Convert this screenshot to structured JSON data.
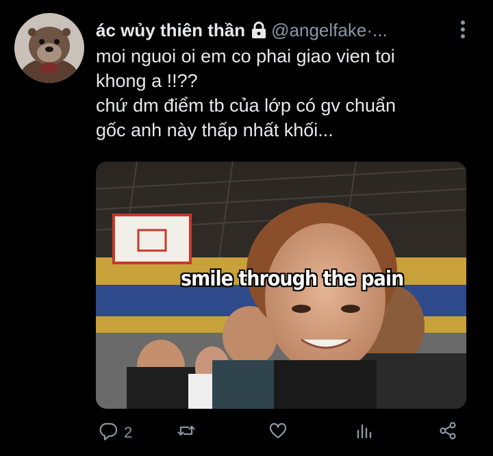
{
  "tweet": {
    "display_name": "ác wủy thiên thần",
    "handle": "@angelfake",
    "handle_suffix": " ·...",
    "text_lines": [
      "moi nguoi oi em co phai giao vien toi",
      "khong a !!??",
      "chứ dm điểm tb của lớp có gv chuẩn",
      "gốc anh này thấp nhất khối..."
    ],
    "media_caption": "smile through the pain",
    "reply_count": "2"
  },
  "icons": {
    "avatar": "otter-avatar",
    "lock": "lock-icon",
    "more": "more-vertical-icon",
    "reply": "reply-icon",
    "retweet": "retweet-icon",
    "like": "heart-icon",
    "views": "bar-chart-icon",
    "share": "share-icon"
  },
  "colors": {
    "background": "#000000",
    "text": "#e7e9ea",
    "secondary": "#8b98a5"
  }
}
